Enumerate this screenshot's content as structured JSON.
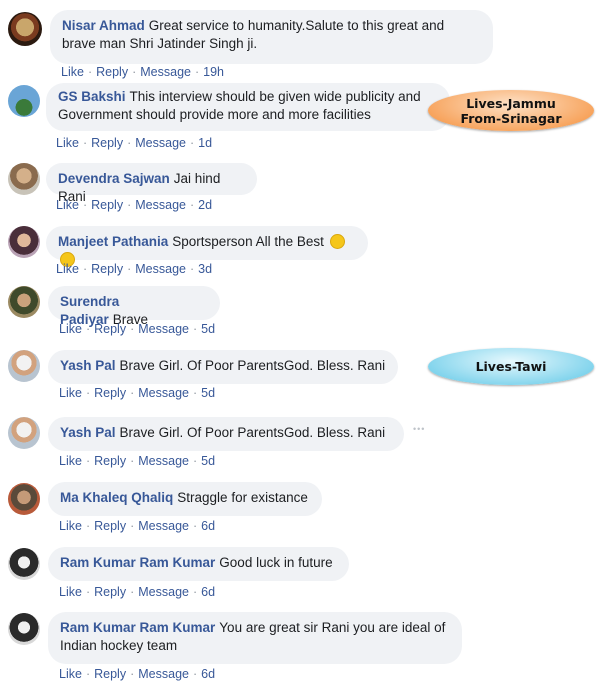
{
  "actions": {
    "like": "Like",
    "reply": "Reply",
    "message": "Message",
    "dot": "·"
  },
  "comments": [
    {
      "author": "Nisar Ahmad",
      "text1": "Great service to humanity.Salute to this great and",
      "text2": "brave man Shri Jatinder Singh ji.",
      "time": "19h"
    },
    {
      "author": "GS Bakshi",
      "text1": "This interview should be given wide publicity and",
      "text2": "Government should provide more and more facilities",
      "time": "1d"
    },
    {
      "author": "Devendra Sajwan",
      "text1": "Jai hind Rani",
      "time": "2d"
    },
    {
      "author": "Manjeet Pathania",
      "text1": "Sportsperson All the Best",
      "time": "3d"
    },
    {
      "author": "Surendra Padiyar",
      "text1": "Brave",
      "time": "5d"
    },
    {
      "author": "Yash Pal",
      "text1": "Brave Girl. Of Poor ParentsGod. Bless. Rani",
      "time": "5d"
    },
    {
      "author": "Yash Pal",
      "text1": "Brave Girl. Of Poor ParentsGod. Bless. Rani",
      "time": "5d"
    },
    {
      "author": "Ma Khaleq Qhaliq",
      "text1": "Straggle for existance",
      "time": "6d"
    },
    {
      "author": "Ram Kumar Ram Kumar",
      "text1": "Good luck in future",
      "time": "6d"
    },
    {
      "author": "Ram Kumar Ram Kumar",
      "text1": "You are great sir Rani you are ideal of",
      "text2": "Indian hockey team",
      "time": "6d"
    }
  ],
  "annotations": {
    "jammu_line1": "Lives-Jammu",
    "jammu_line2": "From-Srinagar",
    "tawi": "Lives-Tawi"
  },
  "more_icon": "•••",
  "colors": {
    "link": "#385898",
    "bubble": "#f0f2f5",
    "orange_callout": "#f7a25a",
    "blue_callout": "#7fd3ec"
  }
}
